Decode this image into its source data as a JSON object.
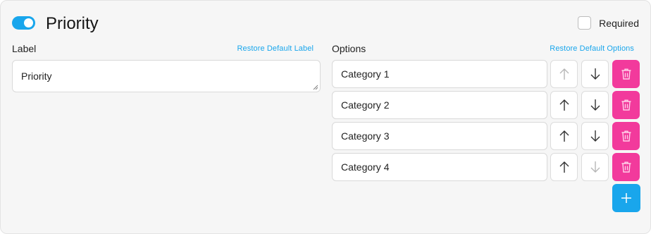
{
  "header": {
    "toggle_on": true,
    "title": "Priority",
    "required_label": "Required",
    "required_checked": false
  },
  "label_section": {
    "heading": "Label",
    "restore_link": "Restore Default Label",
    "value": "Priority"
  },
  "options_section": {
    "heading": "Options",
    "restore_link": "Restore Default Options",
    "options": [
      {
        "value": "Category 1"
      },
      {
        "value": "Category 2"
      },
      {
        "value": "Category 3"
      },
      {
        "value": "Category 4"
      }
    ]
  },
  "colors": {
    "accent": "#19a6ec",
    "danger": "#f23a9c"
  },
  "icons": {
    "move_up": "arrow-up-icon",
    "move_down": "arrow-down-icon",
    "delete": "trash-icon",
    "add": "plus-icon"
  }
}
